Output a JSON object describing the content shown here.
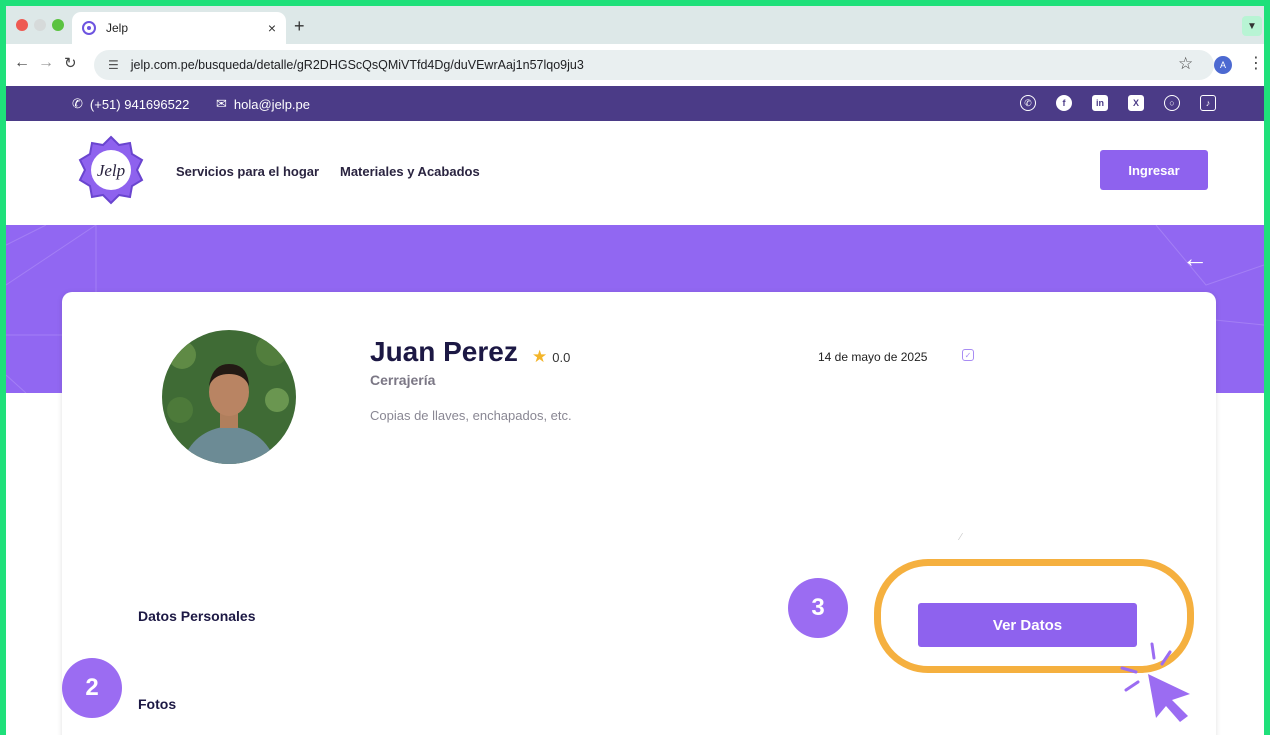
{
  "browser": {
    "tab_title": "Jelp",
    "tab_close": "×",
    "new_tab": "+",
    "url": "jelp.com.pe/busqueda/detalle/gR2DHGScQsQMiVTfd4Dg/duVEwrAaj1n57lqo9ju3",
    "profile_initial": "A",
    "icons": [
      "back-icon",
      "forward-icon",
      "reload-icon",
      "site-settings-icon",
      "bookmark-star-icon",
      "menu-kebab-icon"
    ]
  },
  "topbar": {
    "phone": "(+51) 941696522",
    "email": "hola@jelp.pe",
    "socials": [
      "whatsapp-icon",
      "facebook-icon",
      "linkedin-icon",
      "x-icon",
      "instagram-icon",
      "tiktok-icon"
    ]
  },
  "header": {
    "logo_text": "Jelp",
    "nav": [
      "Servicios para el hogar",
      "Materiales y Acabados"
    ],
    "login_label": "Ingresar"
  },
  "profile": {
    "name": "Juan Perez",
    "rating": "0.0",
    "category": "Cerrajería",
    "description": "Copias de llaves, enchapados, etc.",
    "date": "14 de mayo de 2025"
  },
  "sections": {
    "personal": "Datos Personales",
    "photos": "Fotos",
    "view_button": "Ver Datos"
  },
  "tutorial": {
    "step3": "3",
    "step2": "2"
  },
  "colors": {
    "accent": "#8e62ee",
    "topbar": "#4b3b87",
    "highlight": "#f5b03f",
    "frame": "#1fe07a"
  }
}
